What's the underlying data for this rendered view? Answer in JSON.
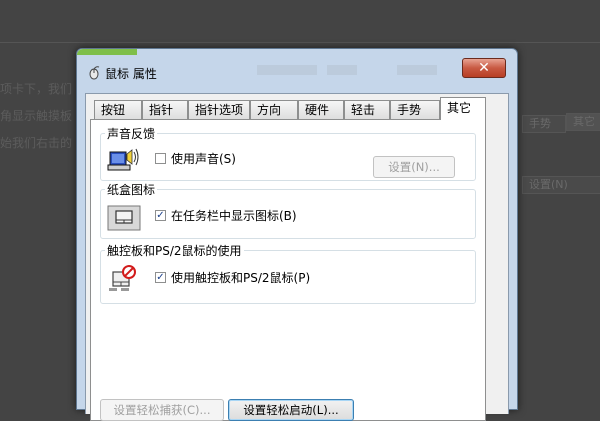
{
  "background": {
    "lines": [
      "项卡下，我们",
      "角显示触摸板",
      "始我们右击的"
    ],
    "right_tabs": [
      "手势",
      "其它"
    ],
    "right_button": "设置(N)"
  },
  "window": {
    "title": "鼠标 属性",
    "close_label": "✕"
  },
  "tabs": [
    {
      "label": "按钮",
      "active": false
    },
    {
      "label": "指针",
      "active": false
    },
    {
      "label": "指针选项",
      "active": false
    },
    {
      "label": "方向",
      "active": false
    },
    {
      "label": "硬件",
      "active": false
    },
    {
      "label": "轻击",
      "active": false
    },
    {
      "label": "手势",
      "active": false
    },
    {
      "label": "其它",
      "active": true
    }
  ],
  "groups": {
    "sound": {
      "label": "声音反馈",
      "checkbox_label": "使用声音(S)",
      "checked": false,
      "settings_button": "设置(N)..."
    },
    "tray": {
      "label": "纸盒图标",
      "checkbox_label": "在任务栏中显示图标(B)",
      "checked": true
    },
    "touchpad": {
      "label": "触控板和PS/2鼠标的使用",
      "checkbox_label": "使用触控板和PS/2鼠标(P)",
      "checked": true
    }
  },
  "buttons": {
    "easy_capture": "设置轻松捕获(C)...",
    "easy_launch": "设置轻松启动(L)..."
  },
  "colors": {
    "accent_blue": "#1a3f8a",
    "close_red": "#c85a43",
    "frame": "#c5d6ea"
  }
}
